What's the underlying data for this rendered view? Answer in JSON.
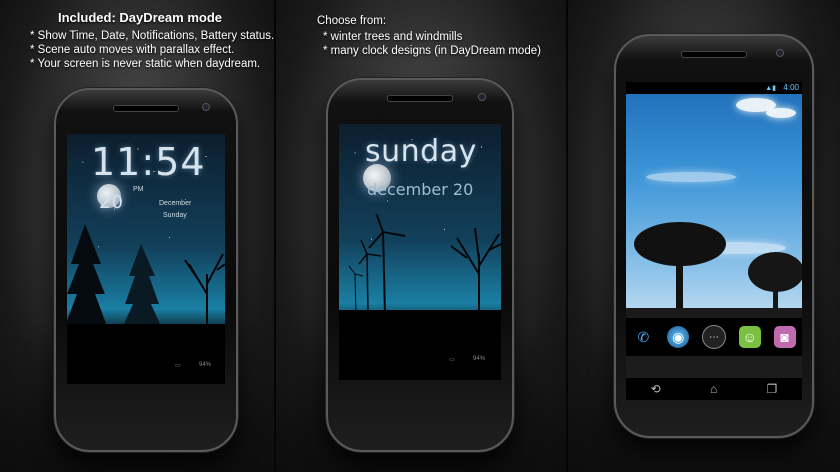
{
  "panel1": {
    "heading": "Included: DayDream mode",
    "bullets": [
      "* Show Time, Date, Notifications, Battery status.",
      "* Scene auto moves with parallax effect.",
      "* Your screen is never static when daydream."
    ],
    "screen": {
      "time": "11:54",
      "am_pm": "PM",
      "day_num": "20",
      "month": "December",
      "weekday": "Sunday",
      "battery": "94%"
    }
  },
  "panel2": {
    "heading": "Choose from:",
    "bullets": [
      "* winter trees and windmills",
      "* many clock designs (in DayDream mode)"
    ],
    "screen": {
      "weekday": "sunday",
      "date": "december 20",
      "battery": "94%"
    }
  },
  "panel3": {
    "status_time": "4:00",
    "dock_icons": [
      "phone-icon",
      "browser-globe-icon",
      "app-drawer-icon",
      "messaging-icon",
      "camera-icon"
    ],
    "nav_icons": [
      "back-icon",
      "home-icon",
      "recent-apps-icon"
    ]
  },
  "colors": {
    "caption_text": "#ffffff",
    "clock_text": "#d7e3ec",
    "status_accent": "#66ccff"
  }
}
